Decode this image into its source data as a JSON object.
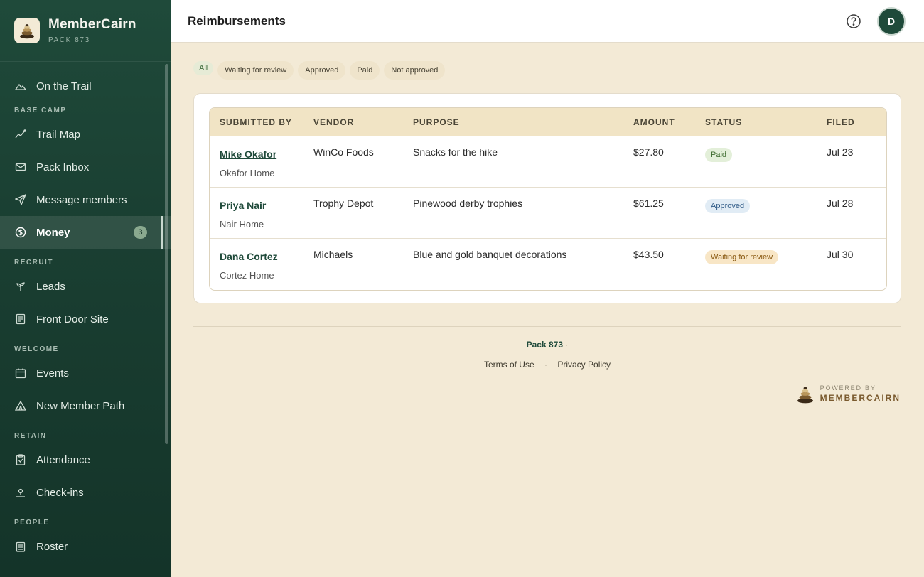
{
  "brand": {
    "name": "MemberCairn",
    "sub": "PACK 873"
  },
  "sidebar": {
    "top_item": {
      "label": "On the Trail",
      "icon": "mountain-icon"
    },
    "sections": [
      {
        "title": "BASE CAMP",
        "items": [
          {
            "label": "Trail Map",
            "icon": "trend-icon"
          },
          {
            "label": "Pack Inbox",
            "icon": "mail-icon"
          },
          {
            "label": "Message members",
            "icon": "send-icon"
          },
          {
            "label": "Money",
            "icon": "dollar-icon",
            "active": true,
            "badge": "3"
          }
        ]
      },
      {
        "title": "RECRUIT",
        "items": [
          {
            "label": "Leads",
            "icon": "sprout-icon"
          },
          {
            "label": "Front Door Site",
            "icon": "page-icon"
          }
        ]
      },
      {
        "title": "WELCOME",
        "items": [
          {
            "label": "Events",
            "icon": "calendar-icon"
          },
          {
            "label": "New Member Path",
            "icon": "tent-icon"
          }
        ]
      },
      {
        "title": "RETAIN",
        "items": [
          {
            "label": "Attendance",
            "icon": "clipboard-icon"
          },
          {
            "label": "Check-ins",
            "icon": "pin-icon"
          }
        ]
      },
      {
        "title": "PEOPLE",
        "items": [
          {
            "label": "Roster",
            "icon": "list-icon"
          }
        ]
      }
    ]
  },
  "header": {
    "title": "Reimbursements",
    "avatar_initial": "D"
  },
  "filters": [
    "All",
    "Waiting for review",
    "Approved",
    "Paid",
    "Not approved"
  ],
  "table": {
    "columns": [
      "SUBMITTED BY",
      "VENDOR",
      "PURPOSE",
      "AMOUNT",
      "STATUS",
      "FILED"
    ],
    "rows": [
      {
        "name": "Mike Okafor",
        "home": "Okafor Home",
        "vendor": "WinCo Foods",
        "purpose": "Snacks for the hike",
        "amount": "$27.80",
        "status": "Paid",
        "filed": "Jul 23"
      },
      {
        "name": "Priya Nair",
        "home": "Nair Home",
        "vendor": "Trophy Depot",
        "purpose": "Pinewood derby trophies",
        "amount": "$61.25",
        "status": "Approved",
        "filed": "Jul 28"
      },
      {
        "name": "Dana Cortez",
        "home": "Cortez Home",
        "vendor": "Michaels",
        "purpose": "Blue and gold banquet decorations",
        "amount": "$43.50",
        "status": "Waiting for review",
        "filed": "Jul 30"
      }
    ]
  },
  "footer": {
    "pack": "Pack 873",
    "terms": "Terms of Use",
    "privacy": "Privacy Policy",
    "dot": "·",
    "powered_by": "POWERED BY",
    "powered_brand": "MEMBERCAIRN"
  },
  "colors": {
    "brand_green": "#1f4a3a",
    "background": "#f3ead6",
    "header_row": "#f1e4c5"
  }
}
